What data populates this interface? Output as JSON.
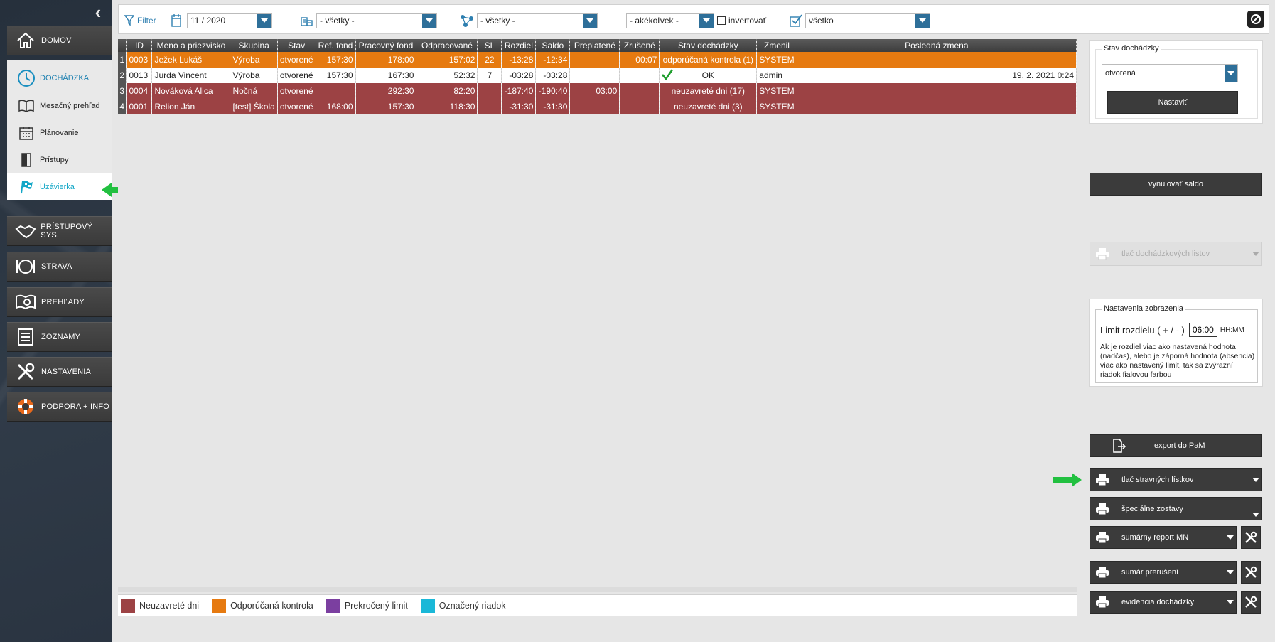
{
  "sidebar": {
    "main_items": [
      {
        "label": "DOMOV",
        "icon": "home-icon"
      },
      {
        "label": "PRÍSTUPOVÝ SYS.",
        "icon": "handshake-icon"
      },
      {
        "label": "STRAVA",
        "icon": "plate-icon"
      },
      {
        "label": "PREHĽADY",
        "icon": "book-search-icon"
      },
      {
        "label": "ZOZNAMY",
        "icon": "list-icon"
      },
      {
        "label": "NASTAVENIA",
        "icon": "tools-icon"
      },
      {
        "label": "PODPORA + INFO",
        "icon": "lifebuoy-icon"
      }
    ],
    "submenu": {
      "title": "DOCHÁDZKA",
      "items": [
        {
          "label": "Mesačný prehľad",
          "icon": "book-icon"
        },
        {
          "label": "Plánovanie",
          "icon": "calendar-icon"
        },
        {
          "label": "Prístupy",
          "icon": "door-icon"
        },
        {
          "label": "Uzávierka",
          "icon": "flag-icon",
          "active": true
        }
      ]
    }
  },
  "toolbar": {
    "filter_label": "Filter",
    "period": "11 / 2020",
    "department": "- všetky -",
    "group": "- všetky -",
    "type": "- akékoľvek -",
    "invert_label": "invertovať",
    "status": "všetko"
  },
  "table": {
    "columns": [
      "ID",
      "Meno a priezvisko",
      "Skupina",
      "Stav",
      "Ref. fond",
      "Pracovný fond",
      "Odpracované",
      "SL",
      "Rozdiel",
      "Saldo",
      "Preplatené",
      "Zrušené",
      "Stav dochádzky",
      "Zmenil",
      "Posledná zmena"
    ],
    "rows": [
      {
        "n": "1",
        "id": "0003",
        "name": "Ježek Lukáš",
        "group": "Výroba",
        "state": "otvorené",
        "ref": "157:30",
        "work": "178:00",
        "done": "157:02",
        "sl": "22",
        "diff": "-13:28",
        "saldo": "-12:34",
        "paid": "",
        "cancel": "00:07",
        "att": "odporúčaná kontrola (1)",
        "changed": "SYSTEM",
        "last": "",
        "style": "orange"
      },
      {
        "n": "2",
        "id": "0013",
        "name": "Jurda Vincent",
        "group": "Výroba",
        "state": "otvorené",
        "ref": "157:30",
        "work": "167:30",
        "done": "52:32",
        "sl": "7",
        "diff": "-03:28",
        "saldo": "-03:28",
        "paid": "",
        "cancel": "",
        "att": "OK",
        "changed": "admin",
        "last": "19. 2. 2021 0:24",
        "style": "white"
      },
      {
        "n": "3",
        "id": "0004",
        "name": "Nováková Alica",
        "group": "Nočná",
        "state": "otvorené",
        "ref": "",
        "work": "292:30",
        "done": "82:20",
        "sl": "",
        "diff": "-187:40",
        "saldo": "-190:40",
        "paid": "03:00",
        "cancel": "",
        "att": "neuzavreté dni (17)",
        "changed": "SYSTEM",
        "last": "",
        "style": "red"
      },
      {
        "n": "4",
        "id": "0001",
        "name": "Relion Ján",
        "group": "[test] Škola",
        "state": "otvorené",
        "ref": "168:00",
        "work": "157:30",
        "done": "118:30",
        "sl": "",
        "diff": "-31:30",
        "saldo": "-31:30",
        "paid": "",
        "cancel": "",
        "att": "neuzavreté dni (3)",
        "changed": "SYSTEM",
        "last": "",
        "style": "red"
      }
    ]
  },
  "legend": [
    {
      "label": "Neuzavreté dni",
      "color": "#9c4244"
    },
    {
      "label": "Odporúčaná kontrola",
      "color": "#e67a10"
    },
    {
      "label": "Prekročený limit",
      "color": "#7b3fa0"
    },
    {
      "label": "Označený riadok",
      "color": "#1ab8d8"
    }
  ],
  "right": {
    "attendance_state_title": "Stav dochádzky",
    "attendance_state_value": "otvorená",
    "set_button": "Nastaviť",
    "reset_saldo": "vynulovať saldo",
    "print_sheets": "tlač dochádzkových listov",
    "display_settings_title": "Nastavenia zobrazenia",
    "limit_label": "Limit rozdielu ( + / - )",
    "limit_value": "06:00",
    "limit_unit": "HH:MM",
    "limit_help": "Ak je rozdiel viac ako nastavená hodnota (nadčas), alebo je záporná hodnota (absencia) viac ako nastavený limit, tak sa zvýrazní riadok fialovou farbou",
    "export_pam": "export do PaM",
    "print_meal": "tlač stravných lístkov",
    "special_reports": "špeciálne zostavy",
    "summary_mn": "sumárny report MN",
    "summary_breaks": "sumár prerušení",
    "attendance_records": "evidencia dochádzky"
  }
}
